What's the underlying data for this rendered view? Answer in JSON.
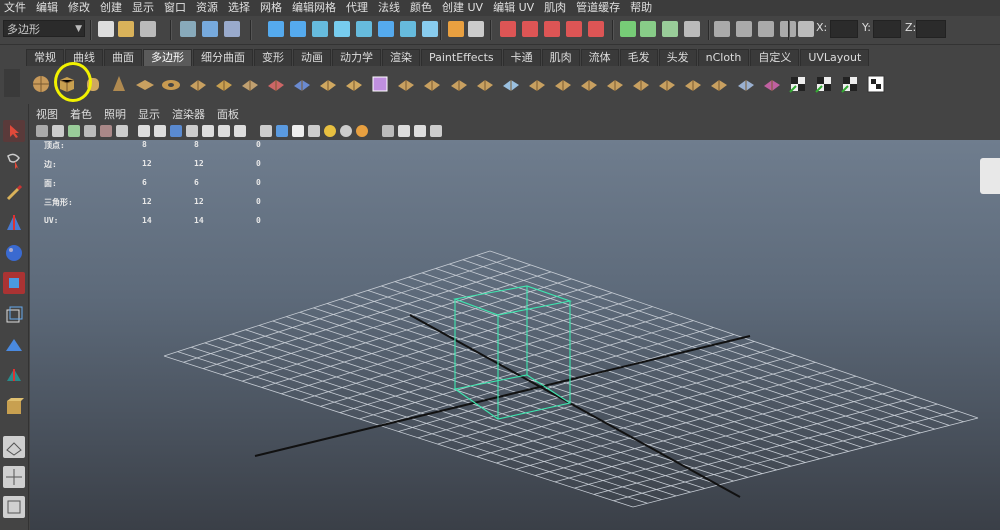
{
  "menu": [
    "文件",
    "编辑",
    "修改",
    "创建",
    "显示",
    "窗口",
    "资源",
    "选择",
    "网格",
    "编辑网格",
    "代理",
    "法线",
    "颜色",
    "创建 UV",
    "编辑 UV",
    "肌肉",
    "管道缓存",
    "帮助"
  ],
  "status": {
    "mode": "多边形",
    "x_label": "X:",
    "y_label": "Y:",
    "z_label": "Z:"
  },
  "shelf_tabs": [
    "常规",
    "曲线",
    "曲面",
    "多边形",
    "细分曲面",
    "变形",
    "动画",
    "动力学",
    "渲染",
    "PaintEffects",
    "卡通",
    "肌肉",
    "流体",
    "毛发",
    "头发",
    "nCloth",
    "自定义",
    "UVLayout"
  ],
  "active_tab": "多边形",
  "shelf_icons": [
    "sphere-icon",
    "cube-icon",
    "cylinder-icon",
    "cone-icon",
    "plane-icon",
    "torus-icon",
    "pyramid-icon",
    "pipe-icon",
    "soccer-ball-icon",
    "append-polygon-icon",
    "combine-icon",
    "separate-icon",
    "mirror-icon",
    "smooth-icon",
    "extrude-face-icon",
    "extrude-edge-icon",
    "bridge-icon",
    "insert-edgeloop-icon",
    "bevel-icon",
    "split-polygon-icon",
    "wedge-icon",
    "poke-icon",
    "merge-icon",
    "collapse-icon",
    "chamfer-icon",
    "delete-edge-icon",
    "reduce-icon",
    "sculpt-icon",
    "uv-planar-icon",
    "uv-cylindrical-icon",
    "uv-spherical-icon",
    "uv-auto-icon",
    "uv-editor-icon"
  ],
  "panel_menu": [
    "视图",
    "着色",
    "照明",
    "显示",
    "渲染器",
    "面板"
  ],
  "hud": [
    {
      "label": "顶点:",
      "a": "8",
      "b": "8",
      "c": "0"
    },
    {
      "label": "边:",
      "a": "12",
      "b": "12",
      "c": "0"
    },
    {
      "label": "面:",
      "a": "6",
      "b": "6",
      "c": "0"
    },
    {
      "label": "三角形:",
      "a": "12",
      "b": "12",
      "c": "0"
    },
    {
      "label": "UV:",
      "a": "14",
      "b": "14",
      "c": "0"
    }
  ]
}
